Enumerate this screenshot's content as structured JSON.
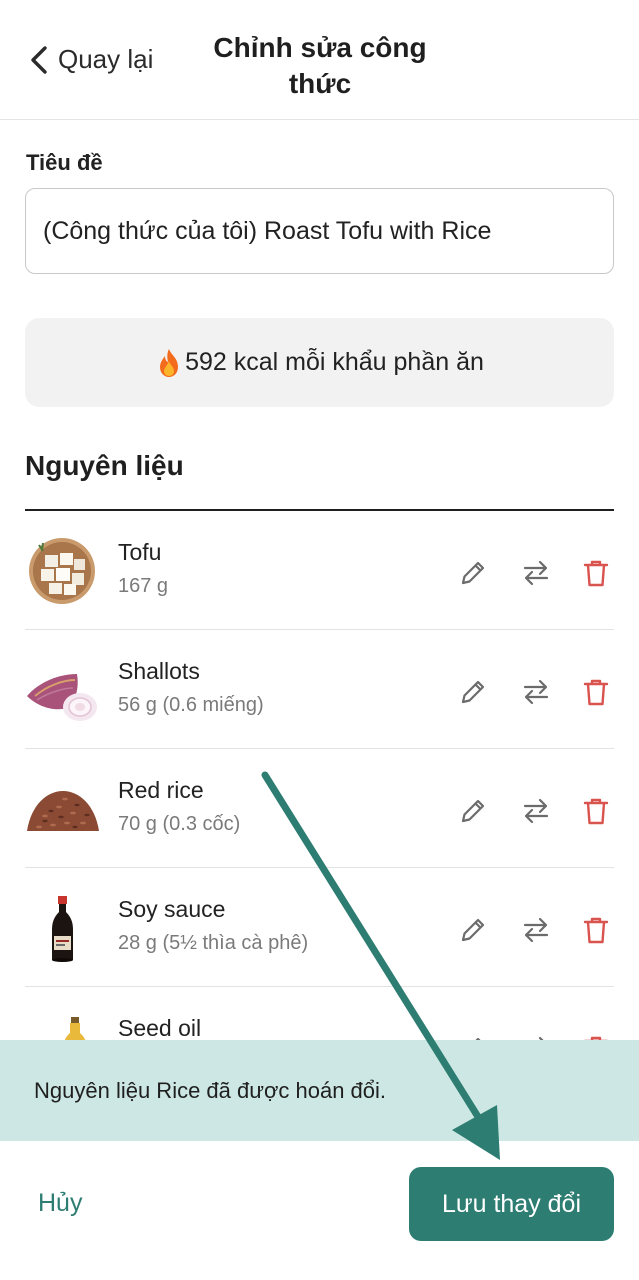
{
  "header": {
    "back_label": "Quay lại",
    "title": "Chỉnh sửa công thức"
  },
  "form": {
    "title_label": "Tiêu đề",
    "title_value": "(Công thức của tôi) Roast Tofu with Rice"
  },
  "nutrition": {
    "kcal_text": "592 kcal mỗi khẩu phần ăn"
  },
  "ingredients": {
    "heading": "Nguyên liệu",
    "items": [
      {
        "name": "Tofu",
        "amount": "167 g"
      },
      {
        "name": "Shallots",
        "amount": "56 g (0.6 miếng)"
      },
      {
        "name": "Red rice",
        "amount": "70 g (0.3 cốc)"
      },
      {
        "name": "Soy sauce",
        "amount": "28 g (5½ thìa cà phê)"
      },
      {
        "name": "Seed oil",
        "amount": ""
      }
    ]
  },
  "toast": {
    "message": "Nguyên liệu Rice đã được hoán đổi."
  },
  "footer": {
    "cancel_label": "Hủy",
    "save_label": "Lưu thay đổi"
  },
  "colors": {
    "accent": "#2e7d72",
    "toast_bg": "#cde8e4",
    "delete": "#d9534f",
    "annotation_arrow": "#2e7d72"
  }
}
